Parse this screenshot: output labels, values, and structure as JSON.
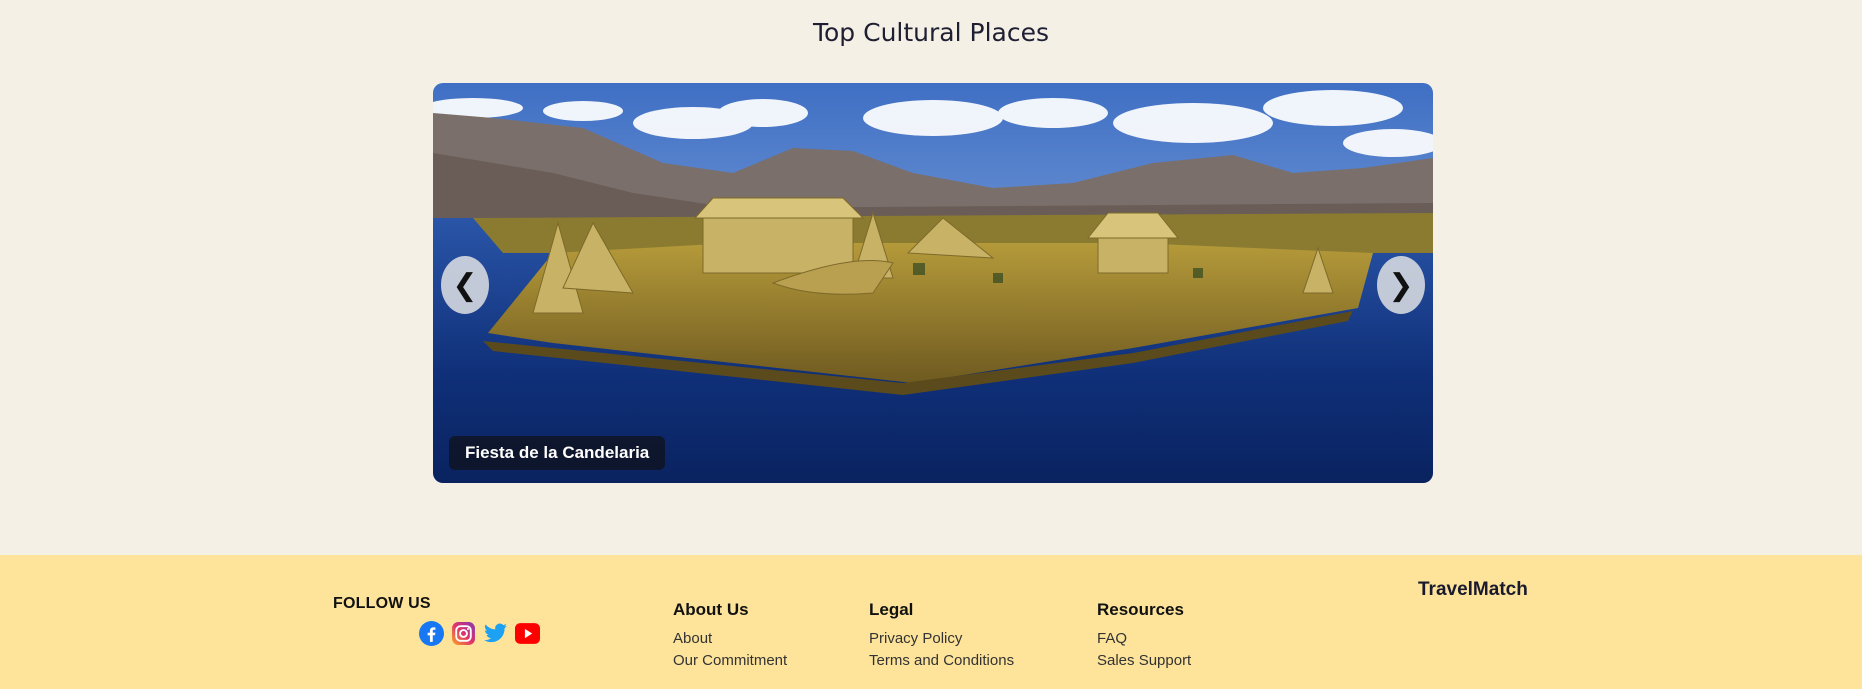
{
  "section": {
    "title": "Top Cultural Places"
  },
  "carousel": {
    "caption": "Fiesta de la Candelaria",
    "prev_label": "❮",
    "next_label": "❯"
  },
  "footer": {
    "follow_title": "FOLLOW US",
    "socials": [
      "facebook-icon",
      "instagram-icon",
      "twitter-icon",
      "youtube-icon"
    ],
    "columns": [
      {
        "title": "About Us",
        "links": [
          "About",
          "Our Commitment"
        ]
      },
      {
        "title": "Legal",
        "links": [
          "Privacy Policy",
          "Terms and Conditions"
        ]
      },
      {
        "title": "Resources",
        "links": [
          "FAQ",
          "Sales Support"
        ]
      }
    ],
    "brand": "TravelMatch"
  },
  "colors": {
    "page_bg": "#f5f0e6",
    "footer_bg": "#fde49a",
    "facebook": "#1877f2",
    "twitter": "#1da1f2",
    "youtube": "#ff0000"
  }
}
